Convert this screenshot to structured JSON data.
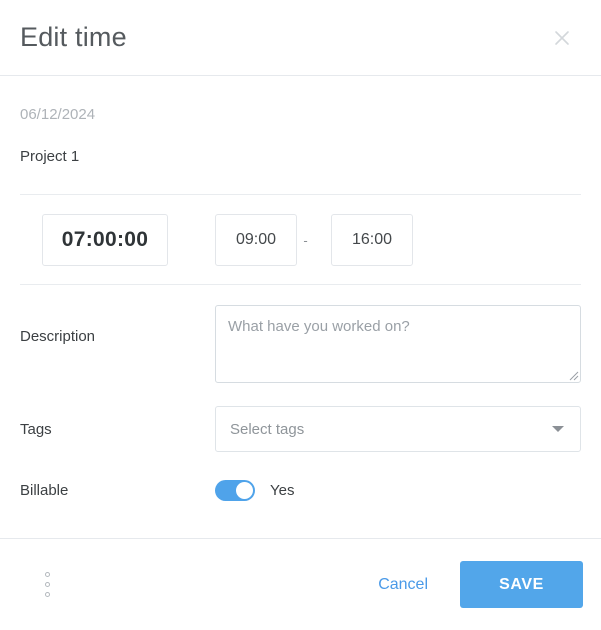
{
  "dialog": {
    "title": "Edit time",
    "close_icon": "close-icon"
  },
  "entry": {
    "date": "06/12/2024",
    "project": "Project 1"
  },
  "time": {
    "duration": "07:00:00",
    "start": "09:00",
    "separator": "-",
    "end": "16:00"
  },
  "description": {
    "label": "Description",
    "value": "",
    "placeholder": "What have you worked on?"
  },
  "tags": {
    "label": "Tags",
    "placeholder": "Select tags",
    "caret_icon": "chevron-down-icon"
  },
  "billable": {
    "label": "Billable",
    "state_label": "Yes",
    "enabled": true
  },
  "footer": {
    "more_icon": "more-vertical-icon",
    "cancel_label": "Cancel",
    "save_label": "SAVE"
  },
  "colors": {
    "accent": "#52a6ea",
    "link": "#4a9ae8",
    "toggle_on": "#4fa3ea",
    "border": "#e6e9ed",
    "muted_text": "#aeb3b8"
  }
}
